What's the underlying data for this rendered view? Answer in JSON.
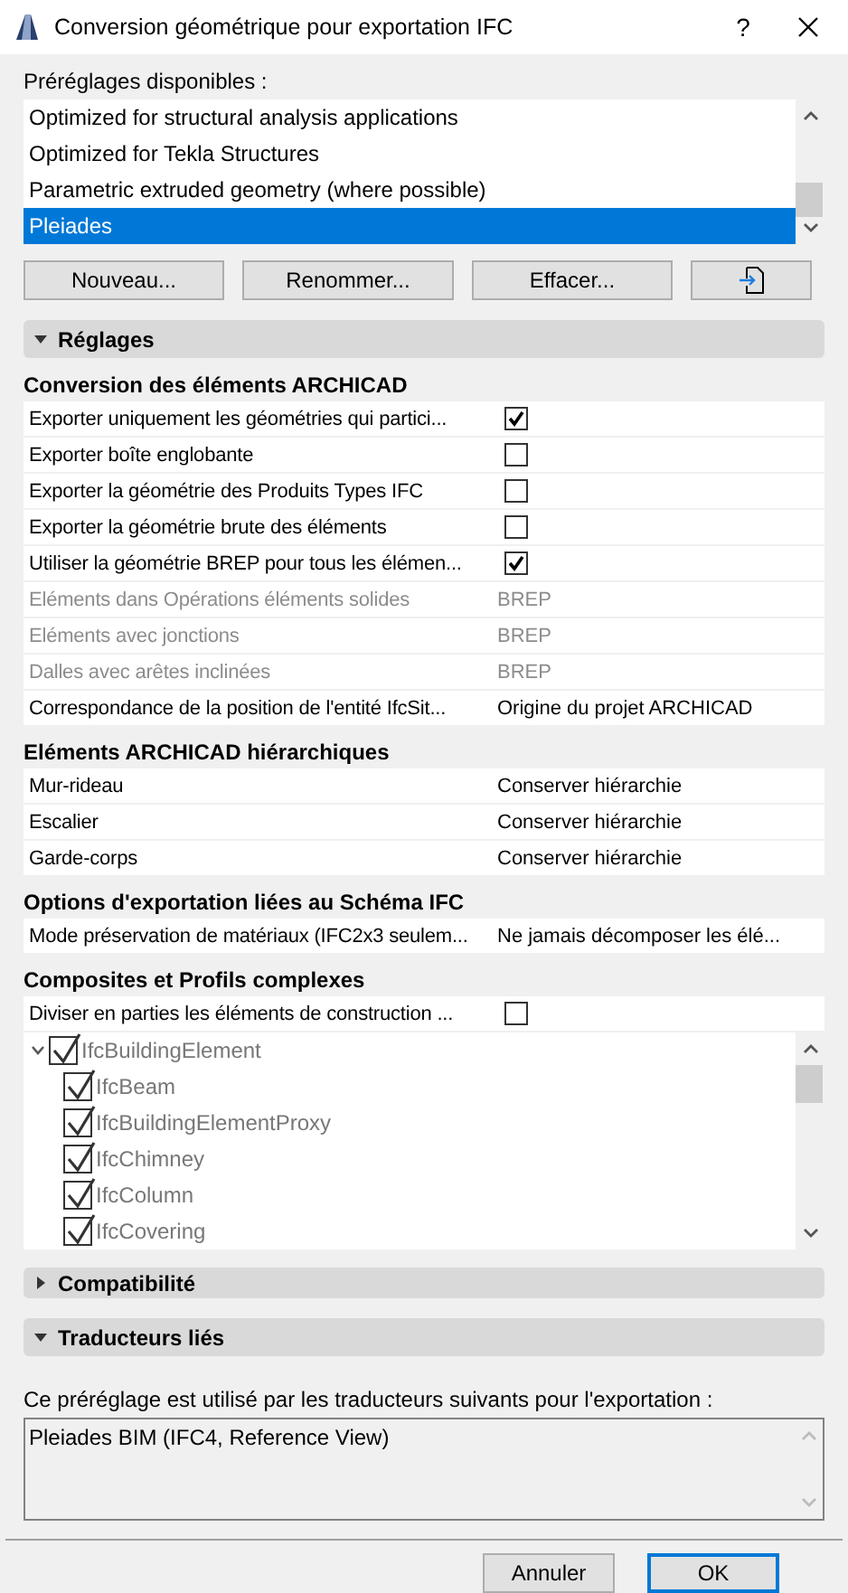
{
  "window": {
    "title": "Conversion géométrique pour exportation IFC",
    "help": "?"
  },
  "presets": {
    "label": "Préréglages disponibles :",
    "items": [
      {
        "label": "Optimized for structural analysis applications",
        "selected": false
      },
      {
        "label": "Optimized for Tekla Structures",
        "selected": false
      },
      {
        "label": "Parametric extruded geometry (where possible)",
        "selected": false
      },
      {
        "label": "Pleiades",
        "selected": true
      }
    ],
    "buttons": [
      "Nouveau...",
      "Renommer...",
      "Effacer..."
    ]
  },
  "panels": [
    {
      "title": "Réglages",
      "expanded": true,
      "groups": [
        {
          "title": "Conversion des éléments ARCHICAD",
          "rows": [
            {
              "kind": "checkbox",
              "label": "Exporter uniquement les géométries qui partici...",
              "checked": true,
              "disabled": false
            },
            {
              "kind": "checkbox",
              "label": "Exporter boîte englobante",
              "checked": false,
              "disabled": false
            },
            {
              "kind": "checkbox",
              "label": "Exporter la géométrie des Produits Types IFC",
              "checked": false,
              "disabled": false
            },
            {
              "kind": "checkbox",
              "label": "Exporter la géométrie brute des éléments",
              "checked": false,
              "disabled": false
            },
            {
              "kind": "checkbox",
              "label": "Utiliser la géométrie BREP pour tous les élémen...",
              "checked": true,
              "disabled": false
            },
            {
              "kind": "value",
              "label": "Eléments dans Opérations éléments solides",
              "value": "BREP",
              "disabled": true
            },
            {
              "kind": "value",
              "label": "Eléments avec jonctions",
              "value": "BREP",
              "disabled": true
            },
            {
              "kind": "value",
              "label": "Dalles avec arêtes inclinées",
              "value": "BREP",
              "disabled": true
            },
            {
              "kind": "value",
              "label": "Correspondance de la position de l'entité IfcSit...",
              "value": "Origine du projet ARCHICAD",
              "disabled": false
            }
          ]
        },
        {
          "title": "Eléments ARCHICAD hiérarchiques",
          "rows": [
            {
              "kind": "value",
              "label": "Mur-rideau",
              "value": "Conserver hiérarchie",
              "disabled": false
            },
            {
              "kind": "value",
              "label": "Escalier",
              "value": "Conserver hiérarchie",
              "disabled": false
            },
            {
              "kind": "value",
              "label": "Garde-corps",
              "value": "Conserver hiérarchie",
              "disabled": false
            }
          ]
        },
        {
          "title": "Options d'exportation liées au Schéma IFC",
          "rows": [
            {
              "kind": "value",
              "label": "Mode préservation de matériaux (IFC2x3 seulem...",
              "value": "Ne jamais décomposer les élé...",
              "disabled": false
            }
          ]
        },
        {
          "title": "Composites et Profils complexes",
          "rows": [
            {
              "kind": "checkbox",
              "label": "Diviser en parties les éléments de construction ...",
              "checked": false,
              "disabled": false
            }
          ],
          "tree": [
            {
              "label": "IfcBuildingElement",
              "checked": true,
              "expanded": true,
              "children": [
                {
                  "label": "IfcBeam",
                  "checked": true
                },
                {
                  "label": "IfcBuildingElementProxy",
                  "checked": true
                },
                {
                  "label": "IfcChimney",
                  "checked": true
                },
                {
                  "label": "IfcColumn",
                  "checked": true
                },
                {
                  "label": "IfcCovering",
                  "checked": true
                }
              ]
            }
          ]
        }
      ]
    },
    {
      "title": "Compatibilité",
      "expanded": false
    },
    {
      "title": "Traducteurs liés",
      "expanded": true,
      "text": "Ce préréglage est utilisé par les traducteurs suivants pour l'exportation :",
      "translators": [
        "Pleiades BIM (IFC4, Reference View)"
      ]
    }
  ],
  "footer": {
    "buttons": [
      {
        "label": "Annuler",
        "default": false
      },
      {
        "label": "OK",
        "default": true
      }
    ]
  }
}
